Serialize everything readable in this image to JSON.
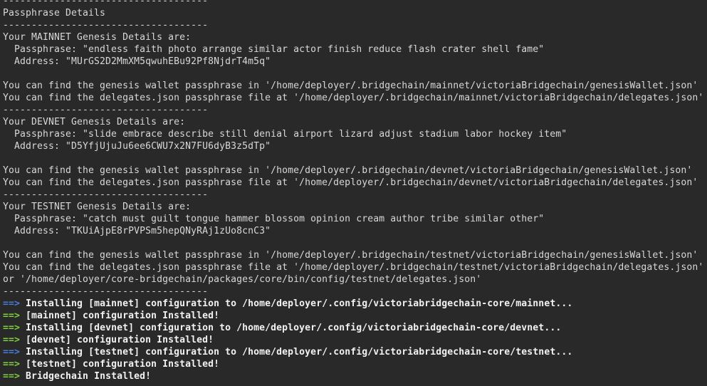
{
  "terminal": {
    "colors": {
      "background": "#292929",
      "foreground": "#d8d8d8",
      "arrow": "#4a7bd8",
      "success": "#7fce3e",
      "bold": "#f2f2f2"
    },
    "lines": [
      "------------------------------------",
      "Passphrase Details",
      "------------------------------------",
      "Your MAINNET Genesis Details are:",
      "  Passphrase: \"endless faith photo arrange similar actor finish reduce flash crater shell fame\"",
      "  Address: \"MUrGS2D2MmXM5qwuhEBu92Pf8NjdrT4m5q\"",
      "",
      "You can find the genesis wallet passphrase in '/home/deployer/.bridgechain/mainnet/victoriaBridgechain/genesisWallet.json'",
      "You can find the delegates.json passphrase file at '/home/deployer/.bridgechain/mainnet/victoriaBridgechain/delegates.json'",
      "------------------------------------",
      "Your DEVNET Genesis Details are:",
      "  Passphrase: \"slide embrace describe still denial airport lizard adjust stadium labor hockey item\"",
      "  Address: \"D5YfjUjuJu6ee6CWU7x2N7FU6dyB3z5dTp\"",
      "",
      "You can find the genesis wallet passphrase in '/home/deployer/.bridgechain/devnet/victoriaBridgechain/genesisWallet.json'",
      "You can find the delegates.json passphrase file at '/home/deployer/.bridgechain/devnet/victoriaBridgechain/delegates.json'",
      "------------------------------------",
      "Your TESTNET Genesis Details are:",
      "  Passphrase: \"catch must guilt tongue hammer blossom opinion cream author tribe similar other\"",
      "  Address: \"TKUiAjpE8rPVPSm5hepQNyRAj1zUo8cnC3\"",
      "",
      "You can find the genesis wallet passphrase in '/home/deployer/.bridgechain/testnet/victoriaBridgechain/genesisWallet.json'",
      "You can find the delegates.json passphrase file at '/home/deployer/.bridgechain/testnet/victoriaBridgechain/delegates.json'",
      "or '/home/deployer/core-bridgechain/packages/core/bin/config/testnet/delegates.json'",
      "------------------------------------"
    ],
    "status_lines": [
      {
        "arrow": "==>",
        "text": "Installing [mainnet] configuration to /home/deployer/.config/victoriabridgechain-core/mainnet..."
      },
      {
        "arrow": "==>",
        "text": "[mainnet] configuration Installed!"
      },
      {
        "arrow": "==>",
        "text": "Installing [devnet] configuration to /home/deployer/.config/victoriabridgechain-core/devnet..."
      },
      {
        "arrow": "==>",
        "text": "[devnet] configuration Installed!"
      },
      {
        "arrow": "==>",
        "text": "Installing [testnet] configuration to /home/deployer/.config/victoriabridgechain-core/testnet..."
      },
      {
        "arrow": "==>",
        "text": "[testnet] configuration Installed!"
      },
      {
        "arrow": "==>",
        "text": "Bridgechain Installed!"
      }
    ]
  }
}
